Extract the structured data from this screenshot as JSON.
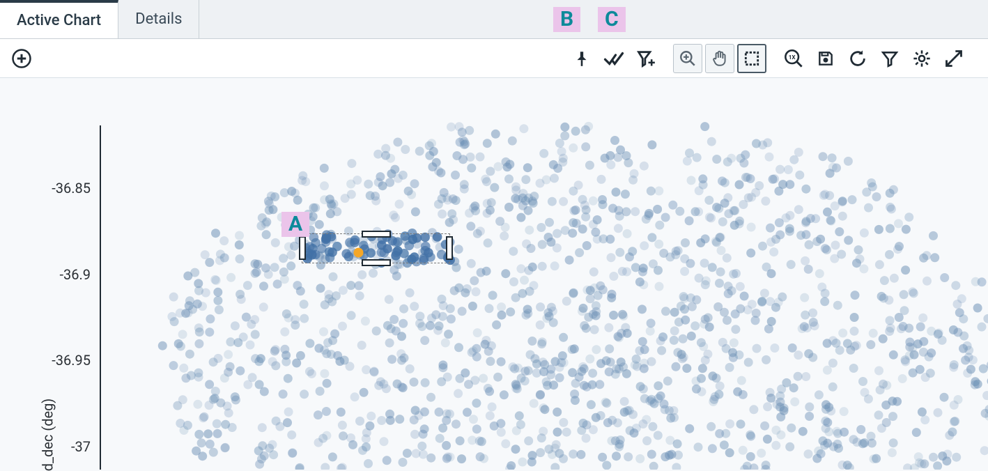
{
  "tabs": {
    "active": "Active Chart",
    "details": "Details"
  },
  "annotations": {
    "A": "A",
    "B": "B",
    "C": "C"
  },
  "toolbar": {
    "add": "add-chart",
    "pin": "pin",
    "select_all": "select-all",
    "add_filter": "add-filter",
    "zoom_in": "zoom-in",
    "pan": "pan",
    "box_select": "box-select",
    "zoom_reset": "zoom-1x",
    "save": "save",
    "reload": "reload",
    "filter": "filter",
    "settings": "settings",
    "expand": "expand"
  },
  "chart_data": {
    "type": "scatter",
    "xlabel": "",
    "ylabel": "d_dec (deg)",
    "y_ticks": [
      -36.85,
      -36.9,
      -36.95,
      -37
    ],
    "ylim": [
      -37.05,
      -36.82
    ],
    "xlim": [
      0,
      1
    ],
    "n_background_points": 1800,
    "selection": {
      "x0": 0.23,
      "x1": 0.4,
      "y0": -36.912,
      "y1": -36.892,
      "n_selected": 70
    },
    "highlight_point": {
      "x": 0.295,
      "y": -36.905,
      "color": "#f5a623"
    },
    "cluster_center_approx": {
      "x": 0.55,
      "y": -36.98
    },
    "cluster_radius_approx_x": 0.48
  },
  "colors": {
    "point": "#6b8fb5",
    "point_selected": "#3f6fa5",
    "highlight": "#f5a623",
    "badge_bg": "#ebc4ea",
    "badge_fg": "#0c8a9a"
  }
}
